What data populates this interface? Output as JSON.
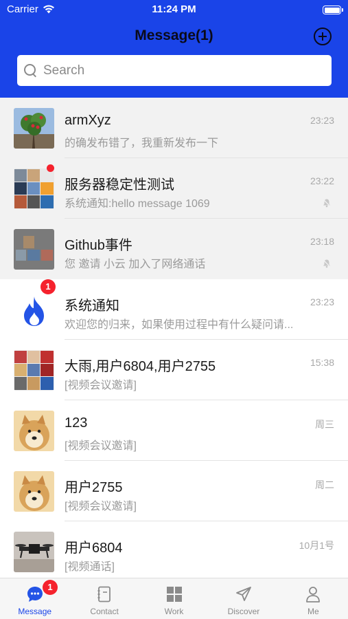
{
  "status_bar": {
    "carrier": "Carrier",
    "time": "11:24 PM"
  },
  "header": {
    "title": "Message(1)",
    "add_icon": "plus-circle-icon"
  },
  "search": {
    "placeholder": "Search",
    "value": ""
  },
  "conversations": [
    {
      "name": "armXyz",
      "preview": "的确发布错了，我重新发布一下",
      "time": "23:23",
      "pinned": true,
      "muted": false,
      "badge": null,
      "avatar": "tree-photo"
    },
    {
      "name": "服务器稳定性测试",
      "preview": "系统通知:hello message 1069",
      "time": "23:22",
      "pinned": true,
      "muted": true,
      "badge": "dot",
      "avatar": "group-grid"
    },
    {
      "name": "Github事件",
      "preview": "您 邀请 小云 加入了网络通话",
      "time": "23:18",
      "pinned": true,
      "muted": true,
      "badge": null,
      "avatar": "group-grid-dark"
    },
    {
      "name": "系统通知",
      "preview": "欢迎您的归来，如果使用过程中有什么疑问请...",
      "time": "23:23",
      "pinned": false,
      "muted": false,
      "badge": "1",
      "avatar": "flame-icon"
    },
    {
      "name": "大雨,用户6804,用户2755",
      "preview": "[视频会议邀请]",
      "time": "15:38",
      "pinned": false,
      "muted": false,
      "badge": null,
      "avatar": "group-grid"
    },
    {
      "name": "123",
      "preview": "[视频会议邀请]",
      "time": "周三",
      "pinned": false,
      "muted": false,
      "badge": null,
      "avatar": "doge"
    },
    {
      "name": "用户2755",
      "preview": "[视频会议邀请]",
      "time": "周二",
      "pinned": false,
      "muted": false,
      "badge": null,
      "avatar": "doge"
    },
    {
      "name": "用户6804",
      "preview": "[视频通话]",
      "time": "10月1号",
      "pinned": false,
      "muted": false,
      "badge": null,
      "avatar": "drone-photo"
    }
  ],
  "tabbar": {
    "message": {
      "label": "Message",
      "badge": "1",
      "icon": "chat-bubble-icon"
    },
    "contact": {
      "label": "Contact",
      "icon": "contact-book-icon"
    },
    "work": {
      "label": "Work",
      "icon": "grid-icon"
    },
    "discover": {
      "label": "Discover",
      "icon": "paper-plane-icon"
    },
    "me": {
      "label": "Me",
      "icon": "person-icon"
    }
  },
  "colors": {
    "brand_blue": "#1a44e8",
    "badge_red": "#f5222d",
    "pinned_bg": "#f2f2f2"
  }
}
